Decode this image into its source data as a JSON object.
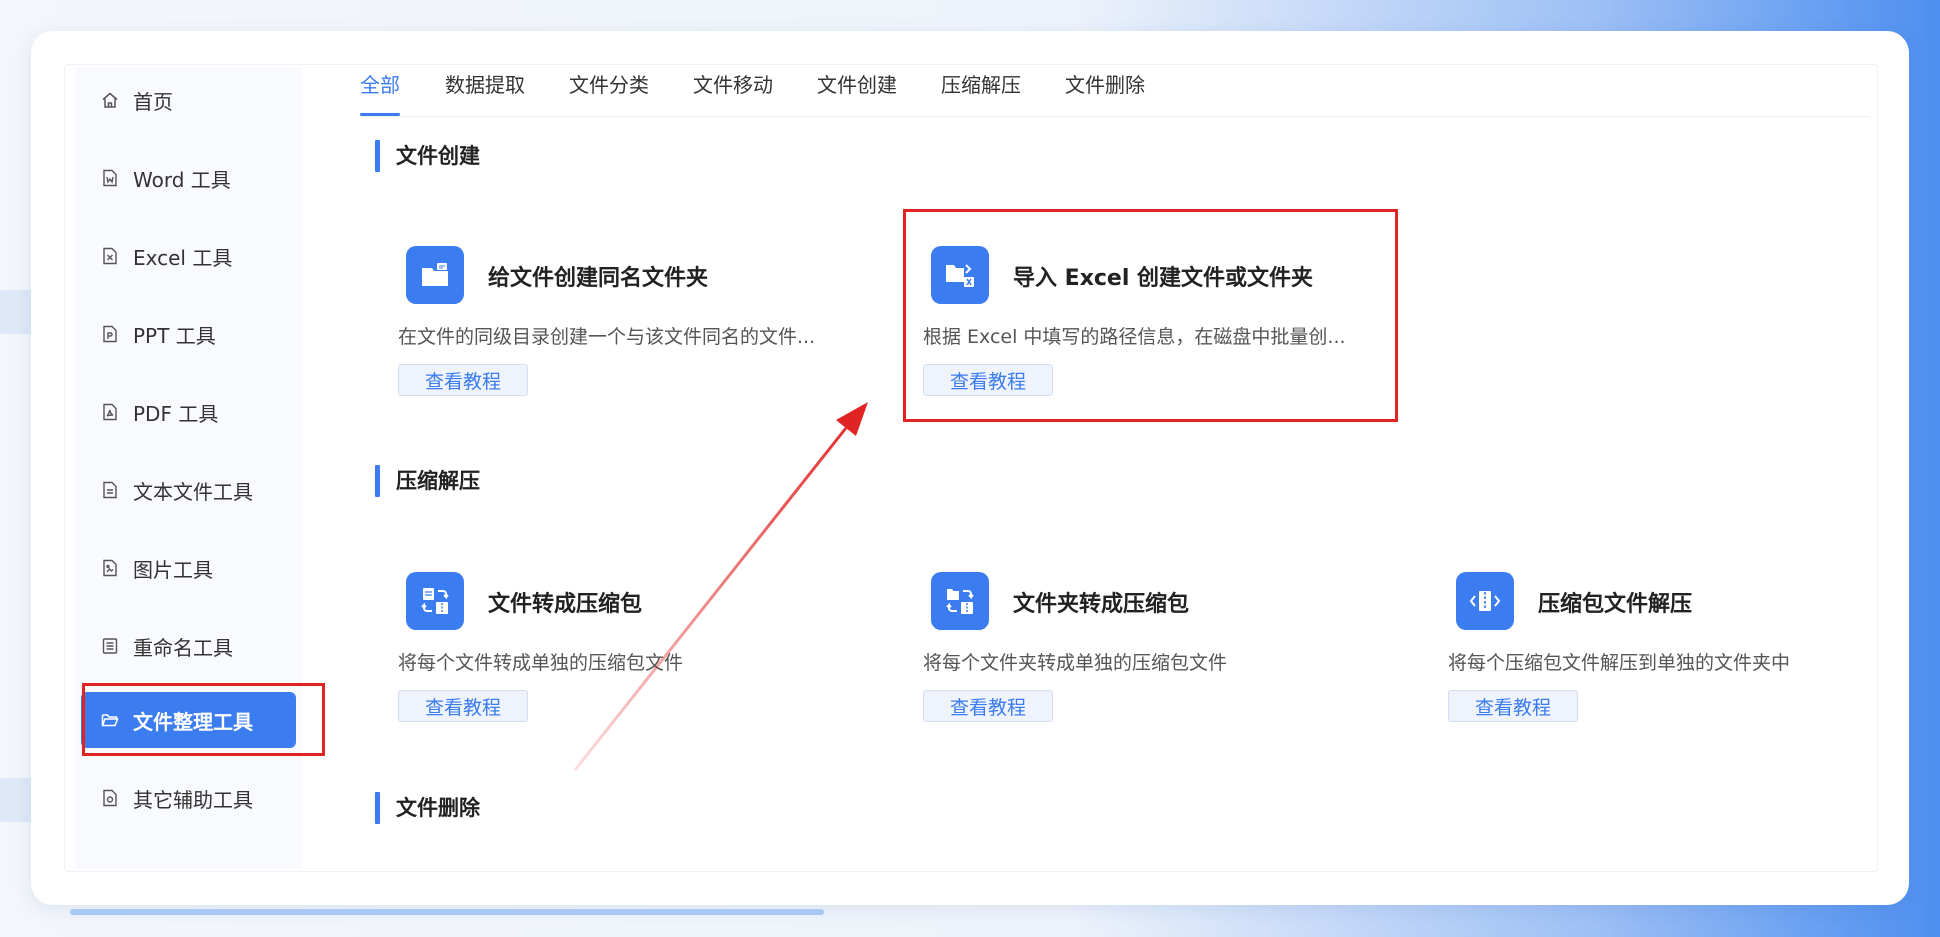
{
  "sidebar": {
    "items": [
      {
        "label": "首页",
        "icon": "home-icon"
      },
      {
        "label": "Word 工具",
        "icon": "word-file-icon"
      },
      {
        "label": "Excel 工具",
        "icon": "excel-file-icon"
      },
      {
        "label": "PPT 工具",
        "icon": "ppt-file-icon"
      },
      {
        "label": "PDF 工具",
        "icon": "pdf-file-icon"
      },
      {
        "label": "文本文件工具",
        "icon": "text-file-icon"
      },
      {
        "label": "图片工具",
        "icon": "image-file-icon"
      },
      {
        "label": "重命名工具",
        "icon": "rename-list-icon"
      },
      {
        "label": "文件整理工具",
        "icon": "folder-open-icon",
        "active": true
      },
      {
        "label": "其它辅助工具",
        "icon": "tools-icon"
      }
    ]
  },
  "tabs": [
    "全部",
    "数据提取",
    "文件分类",
    "文件移动",
    "文件创建",
    "压缩解压",
    "文件删除"
  ],
  "active_tab": "全部",
  "sections": {
    "create": {
      "title": "文件创建",
      "cards": [
        {
          "title": "给文件创建同名文件夹",
          "desc": "在文件的同级目录创建一个与该文件同名的文件...",
          "button": "查看教程",
          "icon": "folder-create-icon"
        },
        {
          "title": "导入 Excel 创建文件或文件夹",
          "desc": "根据 Excel 中填写的路径信息，在磁盘中批量创...",
          "button": "查看教程",
          "icon": "excel-import-folder-icon"
        }
      ]
    },
    "compress": {
      "title": "压缩解压",
      "cards": [
        {
          "title": "文件转成压缩包",
          "desc": "将每个文件转成单独的压缩包文件",
          "button": "查看教程",
          "icon": "file-to-zip-icon"
        },
        {
          "title": "文件夹转成压缩包",
          "desc": "将每个文件夹转成单独的压缩包文件",
          "button": "查看教程",
          "icon": "folder-to-zip-icon"
        },
        {
          "title": "压缩包文件解压",
          "desc": "将每个压缩包文件解压到单独的文件夹中",
          "button": "查看教程",
          "icon": "unzip-icon"
        }
      ]
    },
    "delete": {
      "title": "文件删除"
    }
  },
  "colors": {
    "accent": "#3b7cf0",
    "highlight": "#e02424"
  }
}
